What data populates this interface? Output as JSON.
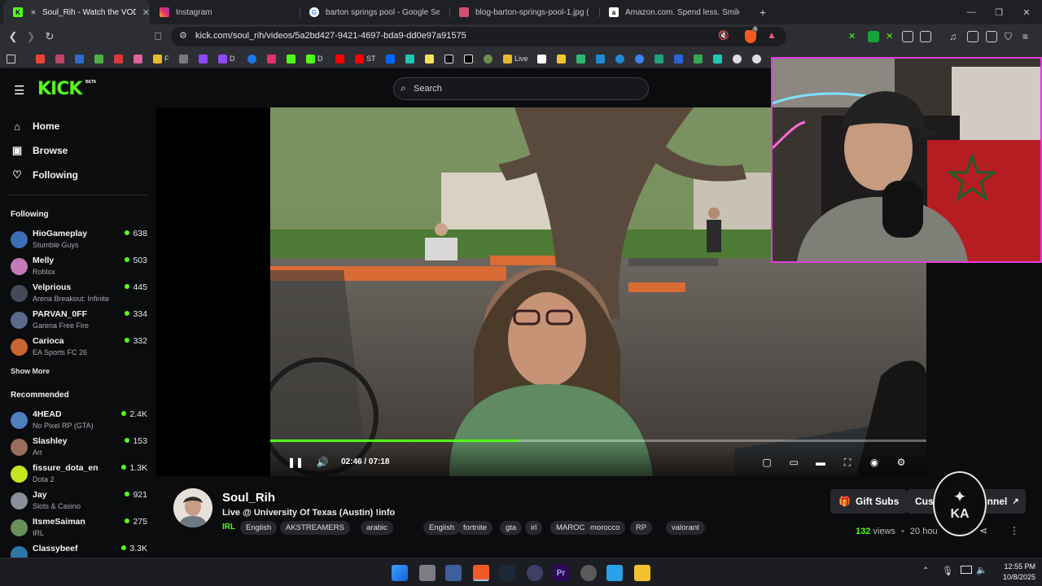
{
  "browser": {
    "tabs": [
      {
        "title": "Soul_Rih - Watch the VOD on",
        "icon": "kick-logo",
        "color": "#53fc18",
        "active": true
      },
      {
        "title": "Instagram",
        "icon": "instagram-logo",
        "color": "#e1306c"
      },
      {
        "title": "barton springs pool - Google Search",
        "icon": "google-logo",
        "color": "#4285f4"
      },
      {
        "title": "blog-barton-springs-pool-1.jpg (120",
        "icon": "image-icon",
        "color": "#d04f76"
      },
      {
        "title": "Amazon.com. Spend less. Smile more.",
        "icon": "amazon-logo",
        "color": "#ffffff"
      }
    ],
    "new_tab": "+",
    "url": "kick.com/soul_rih/videos/5a2bd427-9421-4697-bda9-dd0e97a91575",
    "brave_badge": "3",
    "bookmarks": [
      "F",
      "D",
      "D",
      "ST",
      "Live"
    ]
  },
  "kick": {
    "logo": "KICK",
    "beta": "BETA",
    "search_placeholder": "Search",
    "nav": [
      {
        "label": "Home",
        "icon": "home-icon"
      },
      {
        "label": "Browse",
        "icon": "browse-icon"
      },
      {
        "label": "Following",
        "icon": "heart-icon"
      }
    ],
    "following_heading": "Following",
    "following": [
      {
        "name": "HioGameplay",
        "game": "Stumble Guys",
        "viewers": "638",
        "color": "#3a6fb5"
      },
      {
        "name": "Melly",
        "game": "Roblox",
        "viewers": "503",
        "color": "#c27ab8"
      },
      {
        "name": "Velprious",
        "game": "Arena Breakout: Infinite",
        "viewers": "445",
        "color": "#444a57"
      },
      {
        "name": "PARVAN_0FF",
        "game": "Garena Free Fire",
        "viewers": "334",
        "color": "#5c6a8a"
      },
      {
        "name": "Carioca",
        "game": "EA Sports FC 26",
        "viewers": "332",
        "color": "#c9652e"
      }
    ],
    "show_more": "Show More",
    "recommended_heading": "Recommended",
    "recommended": [
      {
        "name": "4HEAD",
        "game": "No Pixel RP (GTA)",
        "viewers": "2.4K",
        "color": "#4e7fbf"
      },
      {
        "name": "Slashley",
        "game": "Art",
        "viewers": "153",
        "color": "#9a6c5a"
      },
      {
        "name": "fissure_dota_en",
        "game": "Dota 2",
        "viewers": "1.3K",
        "color": "#c5e51f"
      },
      {
        "name": "Jay",
        "game": "Slots & Casino",
        "viewers": "921",
        "color": "#8a8f99"
      },
      {
        "name": "ItsmeSaiman",
        "game": "IRL",
        "viewers": "275",
        "color": "#6b8f5a"
      },
      {
        "name": "Classybeef",
        "game": "",
        "viewers": "3.3K",
        "color": "#2f77a8"
      }
    ]
  },
  "player": {
    "time_current": "02:46",
    "time_separator": "/",
    "time_total": "07:18",
    "progress_fraction": 0.379,
    "controls": [
      "pause-icon",
      "volume-icon",
      "pip-icon",
      "theater-icon",
      "miniplayer-icon",
      "fullscreen-icon",
      "speed-icon",
      "settings-icon"
    ]
  },
  "stream": {
    "streamer": "Soul_Rih",
    "title": "Live @ University Of Texas (Austin) !info",
    "category": "IRL",
    "tags": [
      "English",
      "AKSTREAMERS",
      "arabic",
      "English",
      "fortnite",
      "gta",
      "irl",
      "MAROC",
      "morocco",
      "RP",
      "valorant"
    ],
    "gift_subs": "Gift Subs",
    "custom_button": "Cus",
    "custom_button_tail": "nnel",
    "views_count": "132",
    "views_label": "views",
    "age": "20 hou",
    "watermark": "KA"
  },
  "taskbar": {
    "time": "12:55 PM",
    "date": "10/8/2025"
  }
}
